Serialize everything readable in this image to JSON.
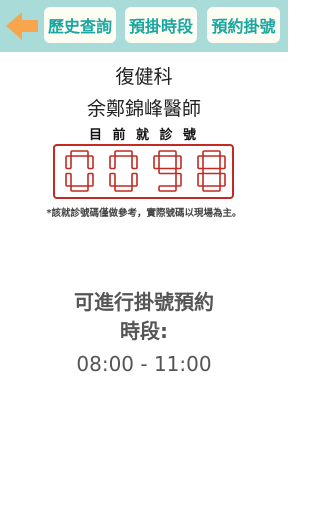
{
  "header": {
    "tabs": [
      {
        "label": "歷史查詢"
      },
      {
        "label": "預掛時段"
      },
      {
        "label": "預約掛號"
      }
    ]
  },
  "department": "復健科",
  "doctor": "余鄭錦峰醫師",
  "current_number_label": "目 前 就 診 號",
  "current_number": "0098",
  "notice": "*該就診號碼僅做參考，實際號碼以現場為主。",
  "slots": {
    "title_line1": "可進行掛號預約",
    "title_line2": "時段:",
    "time_range": "08:00 - 11:00"
  },
  "colors": {
    "header_bg": "#a9dcd8",
    "accent": "#1aa6a0",
    "back_arrow": "#f7a64d",
    "digit_red": "#c22a22"
  }
}
